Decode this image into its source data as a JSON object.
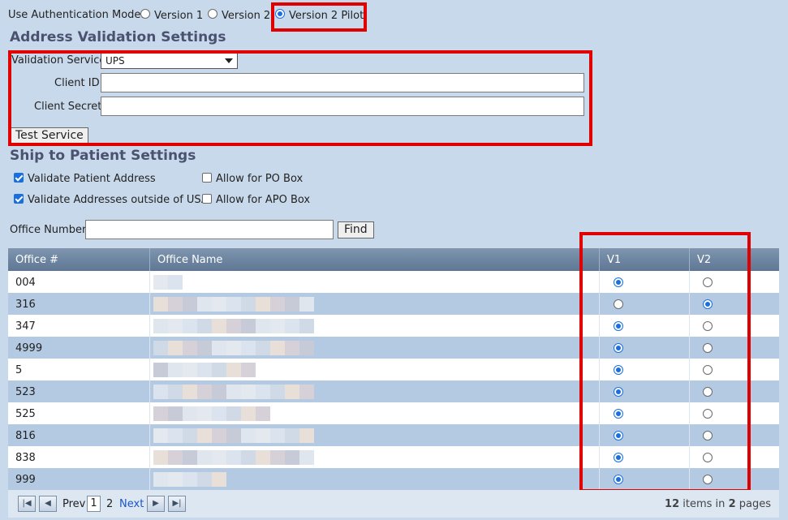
{
  "auth": {
    "label": "Use Authentication Mode:",
    "options": [
      {
        "label": "Version 1",
        "selected": false
      },
      {
        "label": "Version 2",
        "selected": false
      },
      {
        "label": "Version 2 Pilot",
        "selected": true
      }
    ]
  },
  "address": {
    "heading": "Address Validation Settings",
    "service_label": "Validation Service:",
    "service_value": "UPS",
    "client_id_label": "Client ID:",
    "client_id_value": "",
    "client_secret_label": "Client Secret:",
    "client_secret_value": "",
    "test_button": "Test Service"
  },
  "ship": {
    "heading": "Ship to Patient Settings",
    "options": [
      {
        "label": "Validate Patient Address",
        "checked": true
      },
      {
        "label": "Allow for PO Box",
        "checked": false
      },
      {
        "label": "Validate Addresses outside of USA",
        "checked": true
      },
      {
        "label": "Allow for APO Box",
        "checked": false
      }
    ]
  },
  "search": {
    "label": "Office Number",
    "value": "",
    "find_button": "Find"
  },
  "grid": {
    "columns": [
      "Office #",
      "Office Name",
      "V1",
      "V2"
    ],
    "rows": [
      {
        "office": "004",
        "v1": true,
        "v2": false
      },
      {
        "office": "316",
        "v1": false,
        "v2": true
      },
      {
        "office": "347",
        "v1": true,
        "v2": false
      },
      {
        "office": "4999",
        "v1": true,
        "v2": false
      },
      {
        "office": "5",
        "v1": true,
        "v2": false
      },
      {
        "office": "523",
        "v1": true,
        "v2": false
      },
      {
        "office": "525",
        "v1": true,
        "v2": false
      },
      {
        "office": "816",
        "v1": true,
        "v2": false
      },
      {
        "office": "838",
        "v1": true,
        "v2": false
      },
      {
        "office": "999",
        "v1": true,
        "v2": false
      }
    ]
  },
  "pager": {
    "prev": "Prev",
    "pages": [
      "1",
      "2"
    ],
    "current": "1",
    "next": "Next",
    "total_items": "12",
    "items_in": "items in",
    "total_pages": "2",
    "pages_label": "pages"
  },
  "colors": {
    "background": "#c9d9ec",
    "heading": "#4b5270",
    "highlight": "#e00000",
    "accent": "#1a6fe0",
    "row_alt": "#b4c9e2"
  }
}
